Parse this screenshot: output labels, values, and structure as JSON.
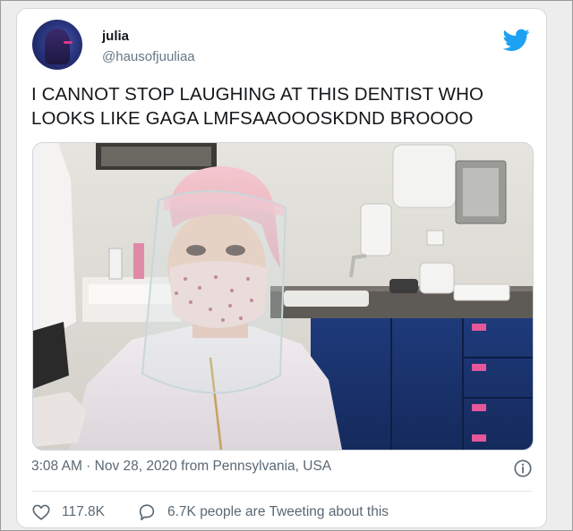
{
  "user": {
    "display_name": "julia",
    "handle": "@hausofjuuliaa",
    "avatar_icon": "profile-avatar"
  },
  "tweet": {
    "text_line1": "I CANNOT STOP LAUGHING AT THIS DENTIST WHO",
    "text_line2": "LOOKS LIKE GAGA LMFSAAOOOSKDND BROOOO"
  },
  "media": {
    "alt": "Video still of a dentist in a pink cap, face shield and patterned mask"
  },
  "meta": {
    "timestamp_source": "3:08 AM · Nov 28, 2020 from Pennsylvania, USA"
  },
  "actions": {
    "likes": "117.8K",
    "replies_text": "6.7K people are Tweeting about this"
  },
  "colors": {
    "twitter_blue": "#1da1f2",
    "text_primary": "#14171a",
    "text_secondary": "#657786"
  },
  "icons": {
    "brand": "twitter-bird-icon",
    "info": "info-icon",
    "like": "heart-icon",
    "reply": "speech-bubble-icon"
  }
}
